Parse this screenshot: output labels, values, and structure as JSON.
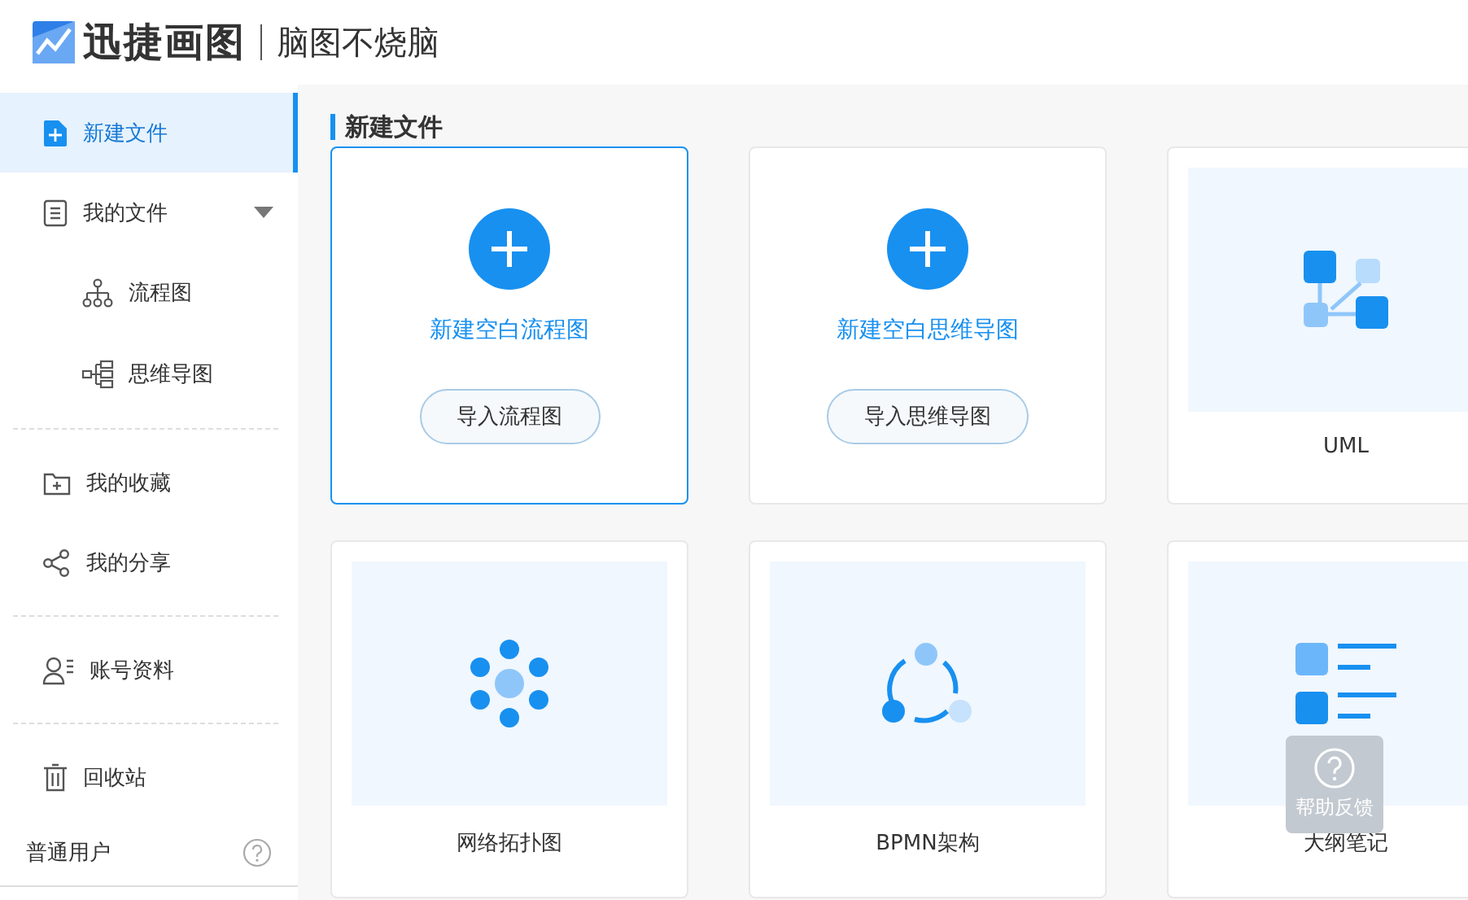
{
  "header": {
    "brand": "迅捷画图",
    "slogan": "脑图不烧脑"
  },
  "sidebar": {
    "groups": [
      [
        {
          "label": "新建文件",
          "selected": true
        },
        {
          "label": "我的文件",
          "selected": false,
          "expanded": true,
          "children": [
            {
              "label": "流程图",
              "selected": false
            },
            {
              "label": "思维导图",
              "selected": false
            }
          ]
        }
      ],
      [
        {
          "label": "我的收藏",
          "selected": false
        },
        {
          "label": "我的分享",
          "selected": false
        }
      ],
      [
        {
          "label": "账号资料",
          "selected": false
        }
      ],
      [
        {
          "label": "回收站",
          "selected": false
        }
      ]
    ],
    "user": {
      "label": "普通用户"
    }
  },
  "main": {
    "title": "新建文件",
    "cards": [
      {
        "kind": "create",
        "selected": true,
        "title": "新建空白流程图",
        "button": "导入流程图"
      },
      {
        "kind": "create",
        "selected": false,
        "title": "新建空白思维导图",
        "button": "导入思维导图"
      },
      {
        "kind": "template",
        "label": "UML"
      },
      {
        "kind": "template",
        "label": "网络拓扑图"
      },
      {
        "kind": "template",
        "label": "BPMN架构"
      },
      {
        "kind": "template",
        "label": "大纲笔记"
      }
    ]
  },
  "help_button": {
    "label": "帮助反馈"
  }
}
